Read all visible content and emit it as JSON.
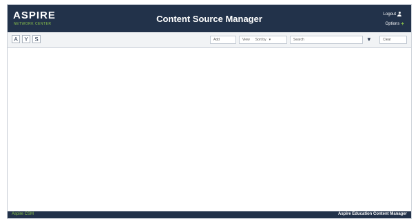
{
  "header": {
    "logo": "ASPIRE",
    "logo_sub": "NETWORK CENTER",
    "title": "Content Source Manager",
    "logout_label": "Logout",
    "options_label": "Options"
  },
  "toolbar": {
    "btn1_glyph": "A",
    "btn2_glyph": "Y",
    "btn3_glyph": "S",
    "add_label": "Add",
    "view_label": "View",
    "sort_label": "Sort by",
    "search_placeholder": "Search",
    "clear_label": "Clear"
  },
  "footer": {
    "left_text": "Aspire CSM",
    "right_text": "Aspire Education Content Manager"
  },
  "colors": {
    "header_bg": "#22324a",
    "accent": "#8bc34a",
    "toolbar_bg": "#f1f3f5"
  }
}
